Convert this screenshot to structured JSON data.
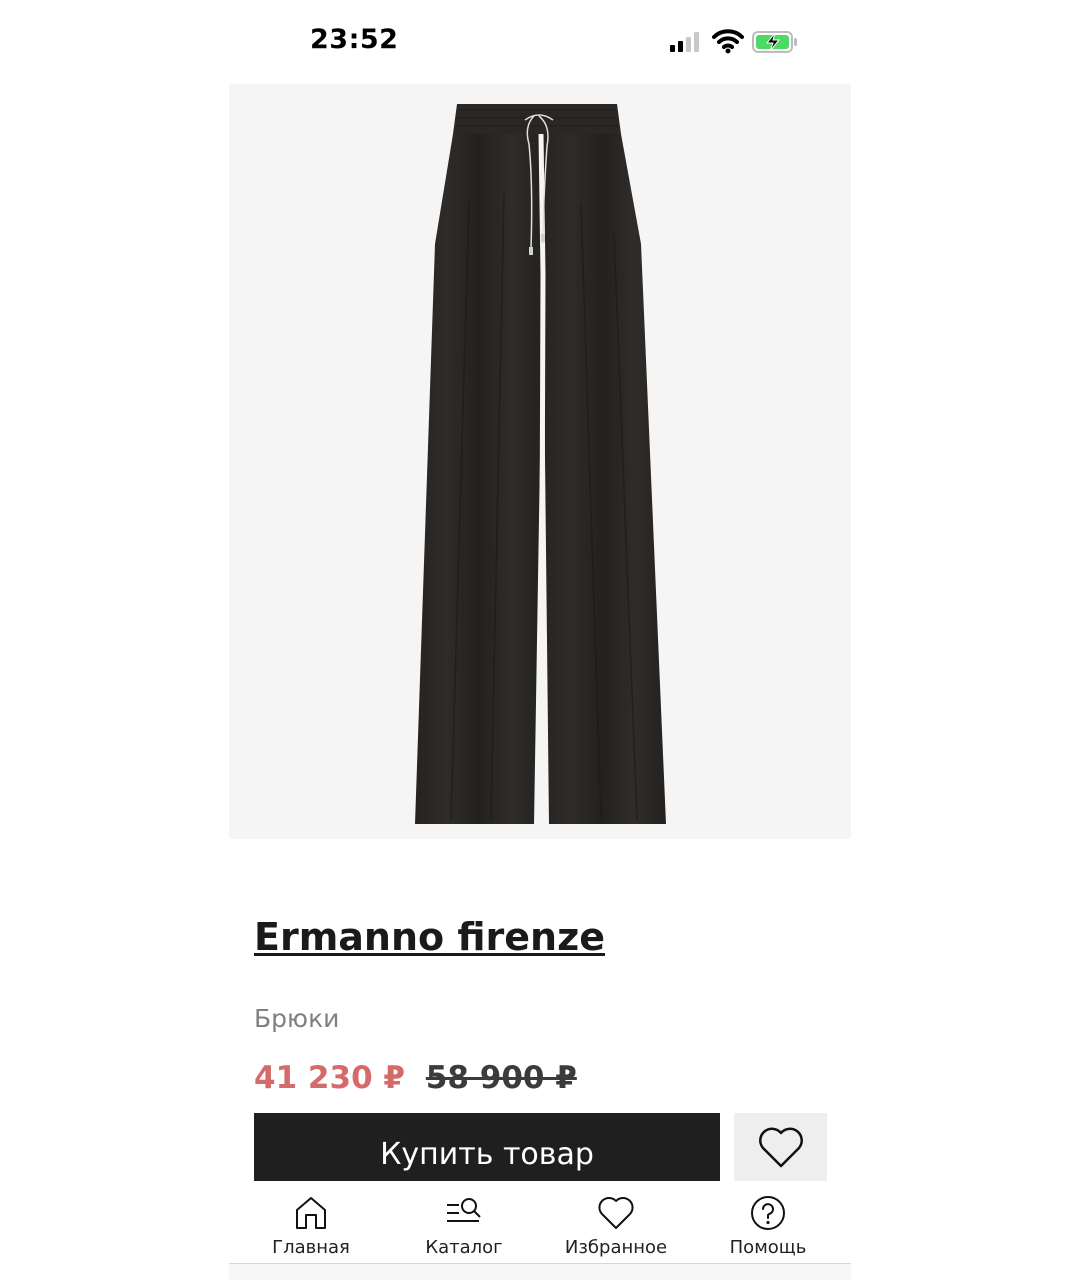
{
  "status_bar": {
    "time": "23:52"
  },
  "product": {
    "image_alt": "wide-leg drawstring trousers",
    "brand": "Ermanno firenze",
    "category": "Брюки",
    "price_current": "41 230 ₽",
    "price_old": "58 900 ₽",
    "buy_label": "Купить товар"
  },
  "colors": {
    "accent_price": "#d46a6a",
    "buy_button": "#1f1f1f",
    "image_bg": "#f5f5f5"
  },
  "bottom_nav": {
    "items": [
      {
        "label": "Главная",
        "icon": "home-icon"
      },
      {
        "label": "Каталог",
        "icon": "catalog-search-icon"
      },
      {
        "label": "Избранное",
        "icon": "heart-icon"
      },
      {
        "label": "Помощь",
        "icon": "help-icon"
      }
    ]
  }
}
